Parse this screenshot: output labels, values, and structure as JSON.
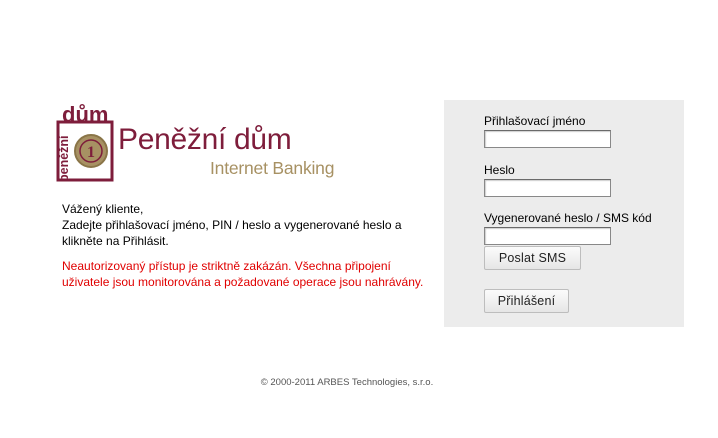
{
  "brand": {
    "name": "Peněžní dům",
    "tagline": "Internet Banking",
    "logo_text_top": "dům",
    "logo_text_side": "peněžní",
    "logo_coin": "1",
    "colors": {
      "primary": "#7e1d3b",
      "gold": "#a79163"
    }
  },
  "intro": {
    "greeting": "Vážený kliente,",
    "line1": "Zadejte přihlašovací jméno, PIN / heslo a vygenerované heslo a",
    "line2": "klikněte na Přihlásit."
  },
  "warning": {
    "line1": "Neautorizovaný přístup je striktně zakázán. Všechna připojení",
    "line2": "uživatele jsou monitorována a požadované operace jsou nahrávány.",
    "color": "#e00000"
  },
  "form": {
    "username_label": "Přihlašovací jméno",
    "username_value": "",
    "password_label": "Heslo",
    "password_value": "",
    "otp_label": "Vygenerované heslo / SMS kód",
    "otp_value": "",
    "send_sms_label": "Poslat SMS",
    "login_label": "Přihlášení"
  },
  "footer": {
    "copyright": "© 2000-2011 ARBES Technologies, s.r.o."
  }
}
